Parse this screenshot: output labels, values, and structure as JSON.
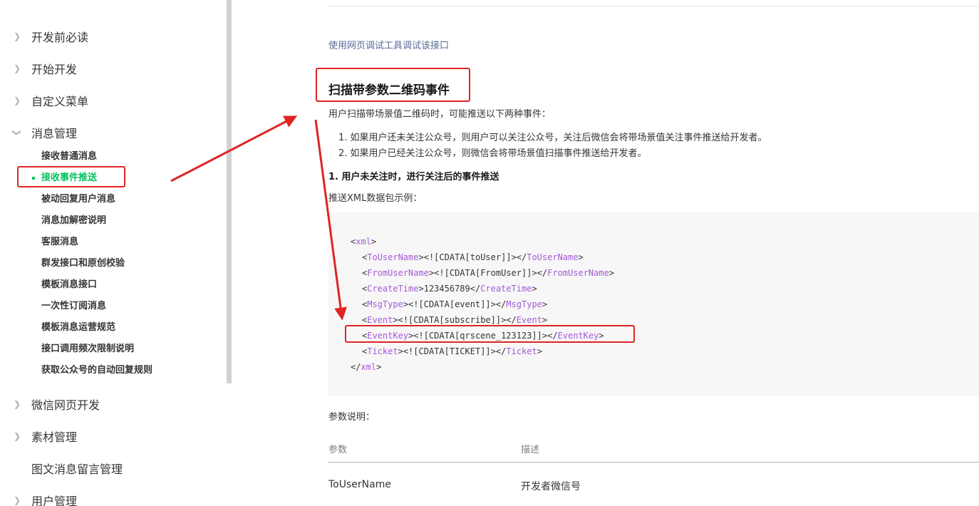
{
  "sidebar": {
    "sections": [
      {
        "label": "开发前必读",
        "expanded": false
      },
      {
        "label": "开始开发",
        "expanded": false
      },
      {
        "label": "自定义菜单",
        "expanded": false
      },
      {
        "label": "消息管理",
        "expanded": true
      },
      {
        "label": "微信网页开发",
        "expanded": false
      },
      {
        "label": "素材管理",
        "expanded": false
      },
      {
        "label": "图文消息留言管理",
        "expanded": false
      },
      {
        "label": "用户管理",
        "expanded": false
      }
    ],
    "sub_items": [
      "接收普通消息",
      "接收事件推送",
      "被动回复用户消息",
      "消息加解密说明",
      "客服消息",
      "群发接口和原创校验",
      "模板消息接口",
      "一次性订阅消息",
      "模板消息运营规范",
      "接口调用频次限制说明",
      "获取公众号的自动回复规则"
    ],
    "active_sub_item": "接收事件推送"
  },
  "content": {
    "debug_link": "使用网页调试工具调试该接口",
    "section_title": "扫描带参数二维码事件",
    "intro": "用户扫描带场景值二维码时，可能推送以下两种事件：",
    "list": [
      "1. 如果用户还未关注公众号，则用户可以关注公众号，关注后微信会将带场景值关注事件推送给开发者。",
      "2. 如果用户已经关注公众号，则微信会将带场景值扫描事件推送给开发者。"
    ],
    "subheading": "1. 用户未关注时，进行关注后的事件推送",
    "xml_label": "推送XML数据包示例：",
    "code": [
      {
        "open": "xml",
        "value": "",
        "close": ""
      },
      {
        "open": "ToUserName",
        "value": "<![CDATA[toUser]]>",
        "close": "ToUserName"
      },
      {
        "open": "FromUserName",
        "value": "<![CDATA[FromUser]]>",
        "close": "FromUserName"
      },
      {
        "open": "CreateTime",
        "value": "123456789",
        "close": "CreateTime"
      },
      {
        "open": "MsgType",
        "value": "<![CDATA[event]]>",
        "close": "MsgType"
      },
      {
        "open": "Event",
        "value": "<![CDATA[subscribe]]>",
        "close": "Event"
      },
      {
        "open": "EventKey",
        "value": "<![CDATA[qrscene_123123]]>",
        "close": "EventKey"
      },
      {
        "open": "Ticket",
        "value": "<![CDATA[TICKET]]>",
        "close": "Ticket"
      },
      {
        "open": "",
        "value": "",
        "close": "xml"
      }
    ],
    "params_label": "参数说明：",
    "table": {
      "headers": [
        "参数",
        "描述"
      ],
      "rows": [
        [
          "ToUserName",
          "开发者微信号"
        ]
      ]
    }
  },
  "colors": {
    "accent": "#07c160",
    "link": "#576b95",
    "tag": "#a45ad6",
    "annotation": "#e02424"
  },
  "icons": {
    "collapsed": "chevron-right-icon",
    "expanded": "chevron-down-icon"
  }
}
